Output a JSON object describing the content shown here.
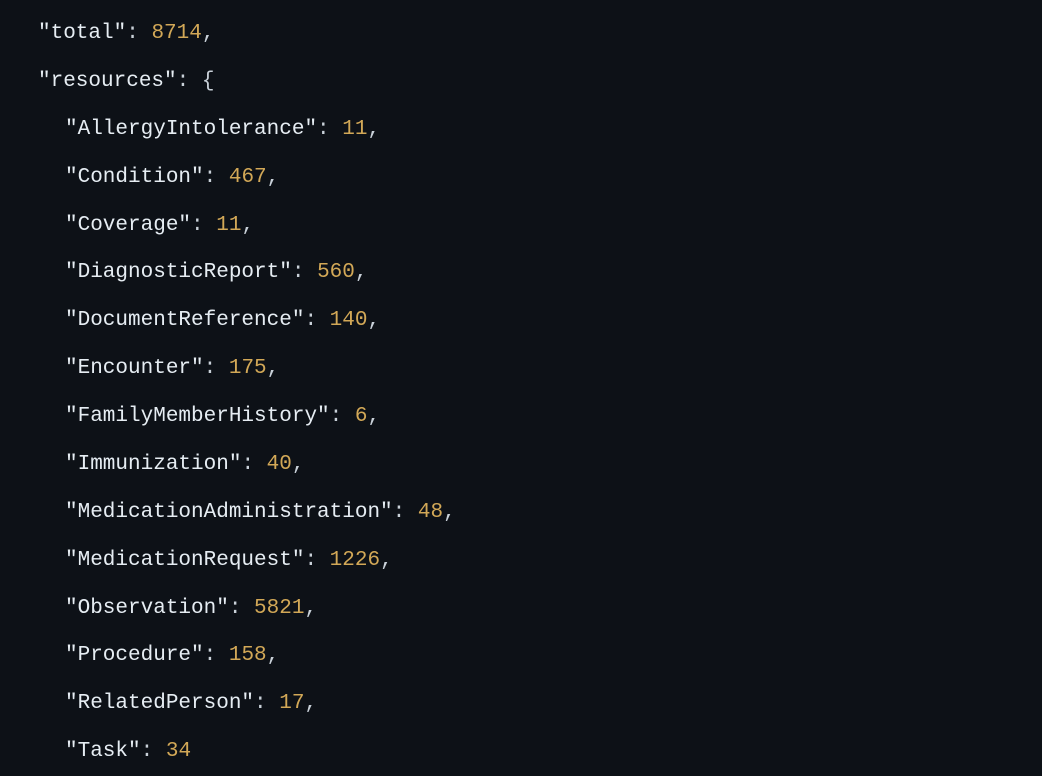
{
  "total_key": "\"total\"",
  "total_value": "8714",
  "resources_key": "\"resources\"",
  "colon_space": ": ",
  "open_brace": "{",
  "comma": ",",
  "entries": [
    {
      "key": "\"AllergyIntolerance\"",
      "value": "11"
    },
    {
      "key": "\"Condition\"",
      "value": "467"
    },
    {
      "key": "\"Coverage\"",
      "value": "11"
    },
    {
      "key": "\"DiagnosticReport\"",
      "value": "560"
    },
    {
      "key": "\"DocumentReference\"",
      "value": "140"
    },
    {
      "key": "\"Encounter\"",
      "value": "175"
    },
    {
      "key": "\"FamilyMemberHistory\"",
      "value": "6"
    },
    {
      "key": "\"Immunization\"",
      "value": "40"
    },
    {
      "key": "\"MedicationAdministration\"",
      "value": "48"
    },
    {
      "key": "\"MedicationRequest\"",
      "value": "1226"
    },
    {
      "key": "\"Observation\"",
      "value": "5821"
    },
    {
      "key": "\"Procedure\"",
      "value": "158"
    },
    {
      "key": "\"RelatedPerson\"",
      "value": "17"
    },
    {
      "key": "\"Task\"",
      "value": "34"
    }
  ]
}
